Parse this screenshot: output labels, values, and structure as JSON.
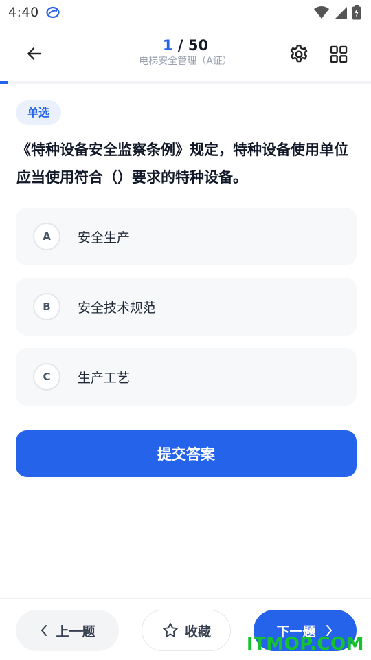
{
  "status_bar": {
    "time": "4:40"
  },
  "header": {
    "current": "1",
    "separator": " / ",
    "total": "50",
    "subtitle": "电梯安全管理（A证）"
  },
  "progress": {
    "fraction": 0.02,
    "color": "#2563eb"
  },
  "question": {
    "type_label": "单选",
    "text": "《特种设备安全监察条例》规定，特种设备使用单位应当使用符合（）要求的特种设备。",
    "options": [
      {
        "letter": "A",
        "text": "安全生产"
      },
      {
        "letter": "B",
        "text": "安全技术规范"
      },
      {
        "letter": "C",
        "text": "生产工艺"
      }
    ]
  },
  "actions": {
    "submit_label": "提交答案"
  },
  "footer": {
    "prev_label": "上一题",
    "favorite_label": "收藏",
    "next_label": "下一题"
  },
  "watermark": "ITMOP.COM",
  "colors": {
    "accent": "#2563eb",
    "watermark": "#16c32f"
  }
}
